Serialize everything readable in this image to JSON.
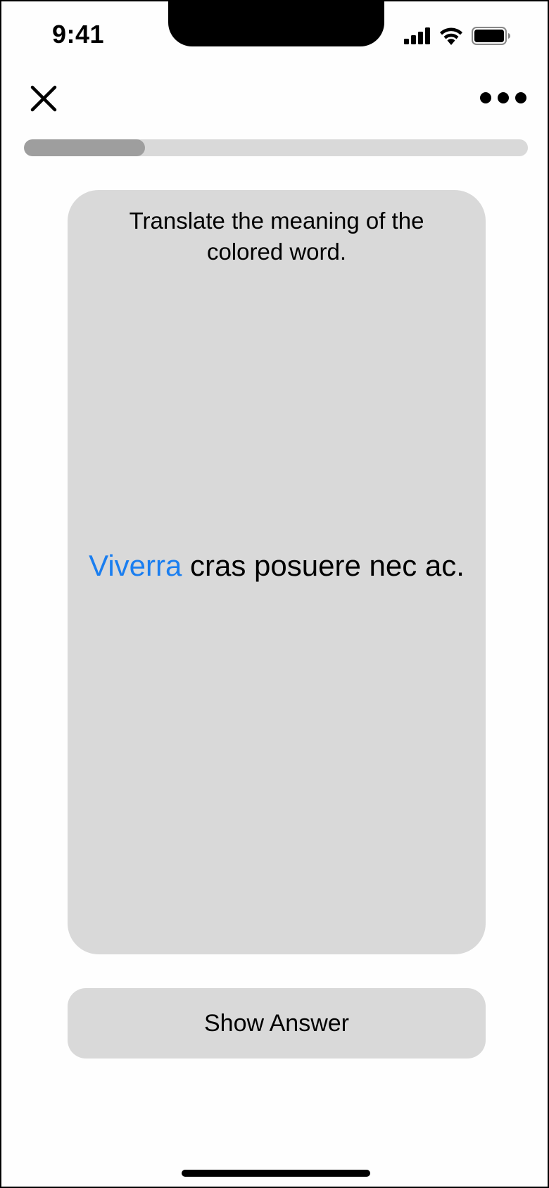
{
  "status_bar": {
    "time": "9:41",
    "signal_icon": "cellular-signal-icon",
    "wifi_icon": "wifi-icon",
    "battery_icon": "battery-icon"
  },
  "header": {
    "close_icon": "close-icon",
    "more_icon": "more-icon"
  },
  "progress": {
    "fraction": 0.24
  },
  "card": {
    "prompt": "Translate the meaning of the colored word.",
    "highlighted_word": "Viverra",
    "rest_of_sentence": " cras posuere nec ac."
  },
  "actions": {
    "show_answer_label": "Show Answer"
  },
  "colors": {
    "accent": "#1a7ef0",
    "card_background": "#d9d9d9",
    "progress_fill": "#9e9e9e"
  }
}
